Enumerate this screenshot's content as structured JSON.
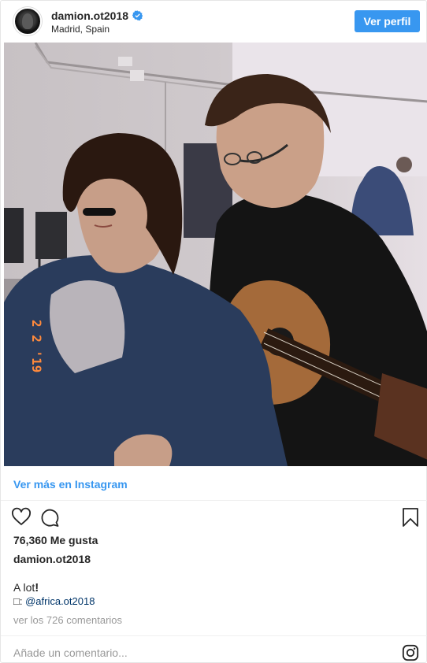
{
  "header": {
    "username": "damion.ot2018",
    "location": "Madrid, Spain",
    "profile_button": "Ver perfil"
  },
  "photo": {
    "timestamp_overlay": "2 2 '19"
  },
  "view_more_link": "Ver más en Instagram",
  "actions": {
    "like_icon": "heart-outline",
    "comment_icon": "speech-bubble-outline",
    "save_icon": "bookmark-outline"
  },
  "likes": "76,360 Me gusta",
  "author": "damion.ot2018",
  "caption": {
    "text": "A lot",
    "emphasis": "!",
    "credit_prefix": "□: ",
    "credit_mention": "@africa.ot2018"
  },
  "comments_link": "ver los 726 comentarios",
  "comment_input": {
    "placeholder": "Añade un comentario...",
    "brand_icon": "instagram-glyph"
  },
  "colors": {
    "accent": "#3897f0",
    "text": "#262626",
    "muted": "#999999",
    "mention": "#003569"
  }
}
